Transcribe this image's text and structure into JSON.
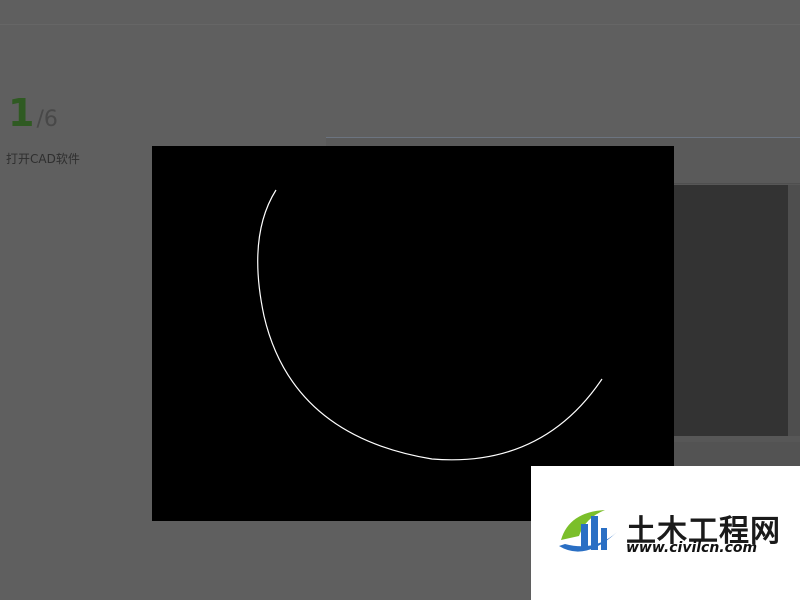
{
  "tutorial": {
    "step_current": "1",
    "step_separator": "/",
    "step_total": "6",
    "step_caption": "打开CAD软件"
  },
  "viewer": {
    "background": "#000000",
    "arc_color": "#ffffff"
  },
  "watermark": {
    "title": "土木工程网",
    "url": "www.civilcn.com",
    "logo_colors": [
      "#2a6fc4",
      "#7bbf2a"
    ]
  }
}
